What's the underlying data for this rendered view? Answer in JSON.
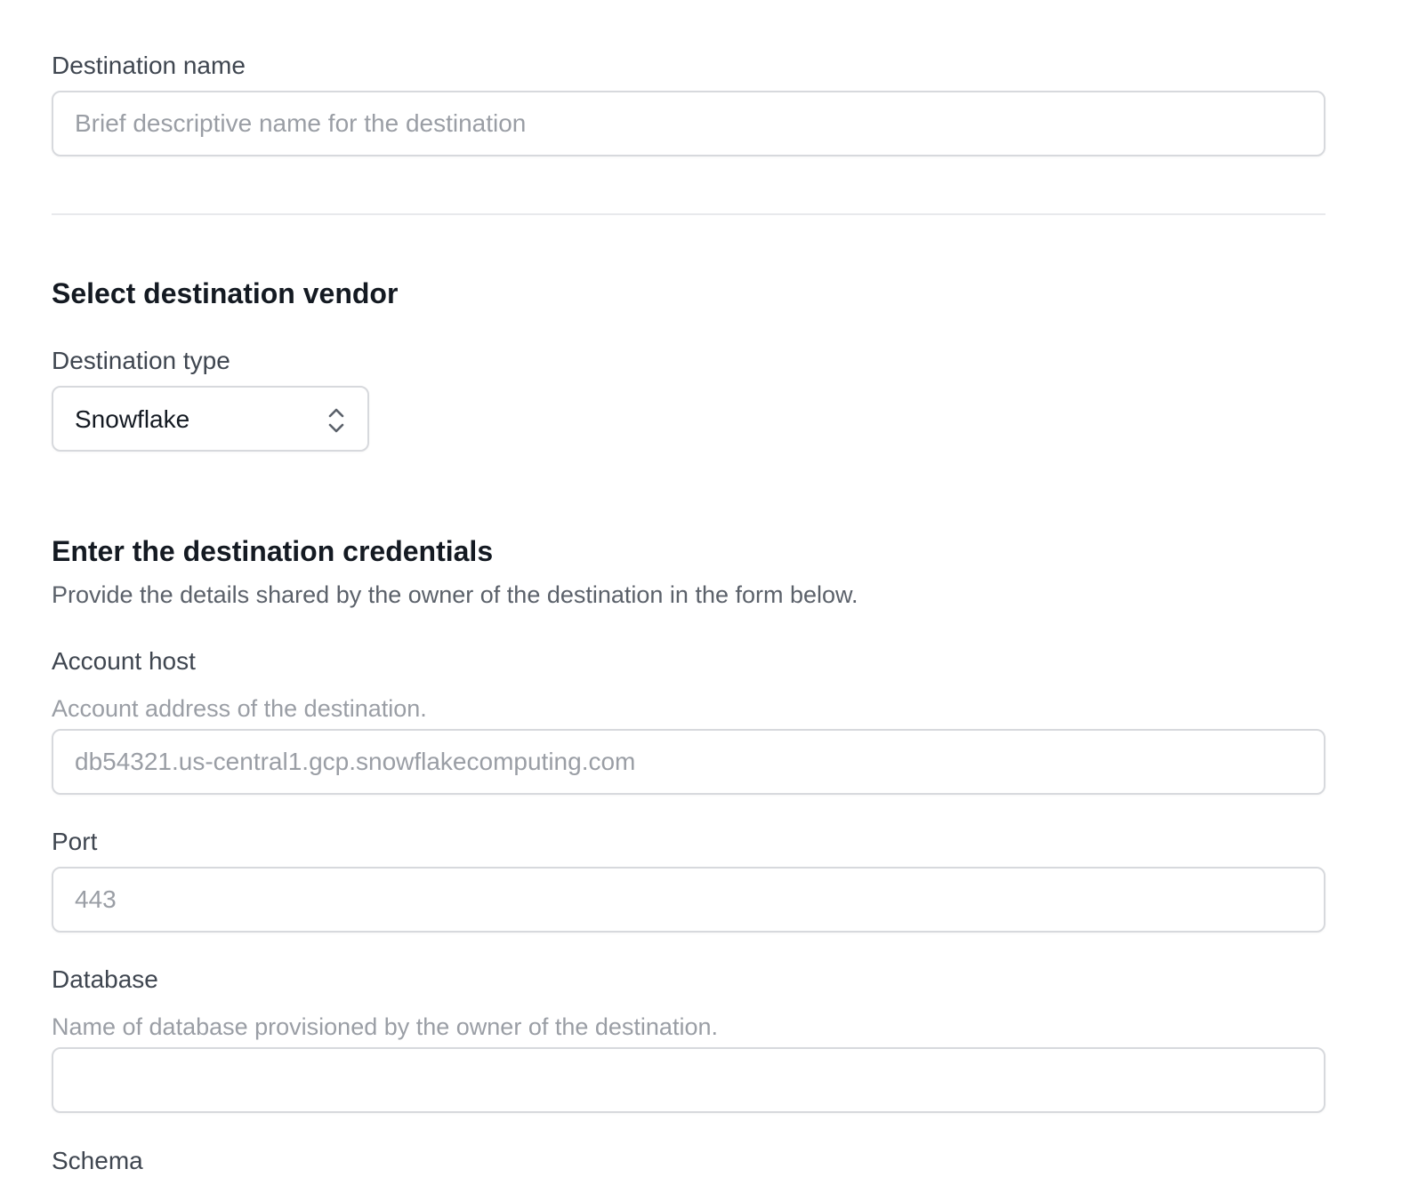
{
  "destination_name": {
    "label": "Destination name",
    "placeholder": "Brief descriptive name for the destination",
    "value": ""
  },
  "vendor_section": {
    "heading": "Select destination vendor",
    "type_label": "Destination type",
    "selected_type": "Snowflake",
    "icon": "chevron-up-down-icon"
  },
  "credentials_section": {
    "heading": "Enter the destination credentials",
    "description": "Provide the details shared by the owner of the destination in the form below.",
    "account_host": {
      "label": "Account host",
      "help": "Account address of the destination.",
      "placeholder": "db54321.us-central1.gcp.snowflakecomputing.com",
      "value": ""
    },
    "port": {
      "label": "Port",
      "placeholder": "443",
      "value": ""
    },
    "database": {
      "label": "Database",
      "help": "Name of database provisioned by the owner of the destination.",
      "placeholder": "",
      "value": ""
    },
    "next_label_partial": "Schema"
  },
  "colors": {
    "border": "#d7d9dd",
    "placeholder": "#9a9ea5",
    "heading": "#141a22",
    "label": "#3f4650"
  }
}
